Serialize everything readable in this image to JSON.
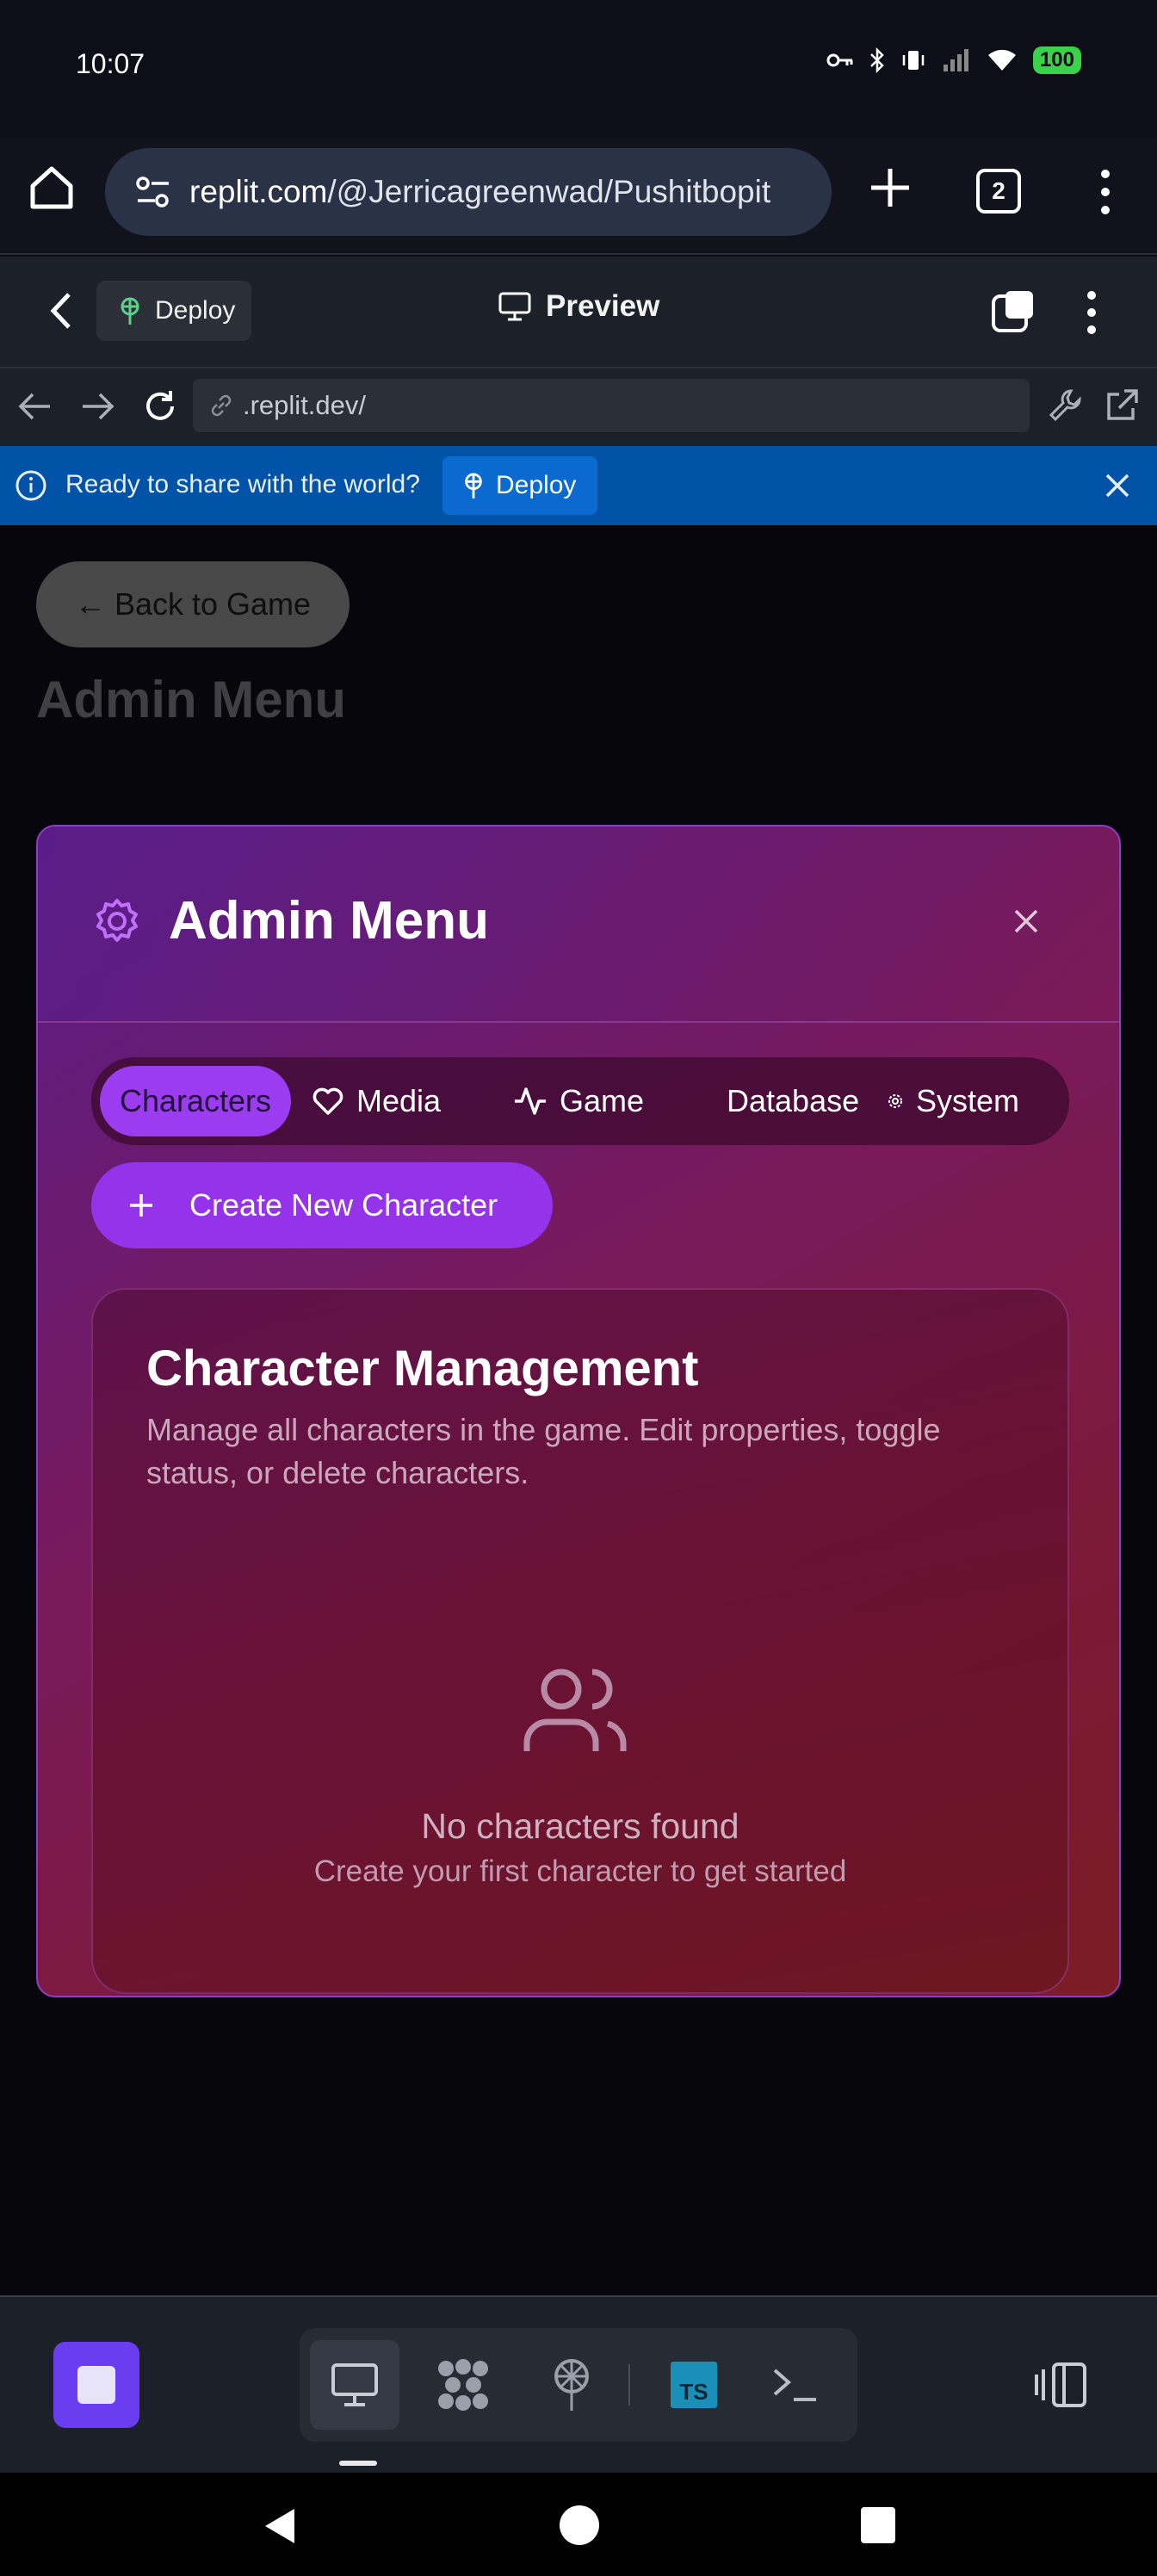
{
  "status_bar": {
    "time": "10:07",
    "battery": "100",
    "icons": [
      "key-icon",
      "bluetooth-icon",
      "vibrate-icon",
      "signal-icon",
      "wifi-icon",
      "battery-icon"
    ]
  },
  "browser": {
    "url_host": "replit.com",
    "url_path": "/@Jerricagreenwad/Pushitbopit",
    "tab_count": "2"
  },
  "replit_header": {
    "deploy_label": "Deploy",
    "preview_label": "Preview"
  },
  "address_bar": {
    "url": ".replit.dev/"
  },
  "banner": {
    "message": "Ready to share with the world?",
    "deploy_label": "Deploy"
  },
  "app": {
    "back_button": "← Back to Game",
    "background_title": "Admin Menu"
  },
  "modal": {
    "title": "Admin Menu",
    "tabs": [
      {
        "label": "Characters",
        "active": true
      },
      {
        "label": "Media"
      },
      {
        "label": "Game"
      },
      {
        "label": "Database"
      },
      {
        "label": "System"
      }
    ],
    "create_button": "Create New Character",
    "card": {
      "title": "Character Management",
      "description": "Manage all characters in the game. Edit properties, toggle status, or delete characters.",
      "empty_title": "No characters found",
      "empty_subtitle": "Create your first character to get started"
    }
  },
  "toolbar": {
    "ts_label": "TS"
  },
  "colors": {
    "accent_purple": "#9433ea",
    "banner_blue": "#0053a6",
    "battery_green": "#3ad14b"
  }
}
